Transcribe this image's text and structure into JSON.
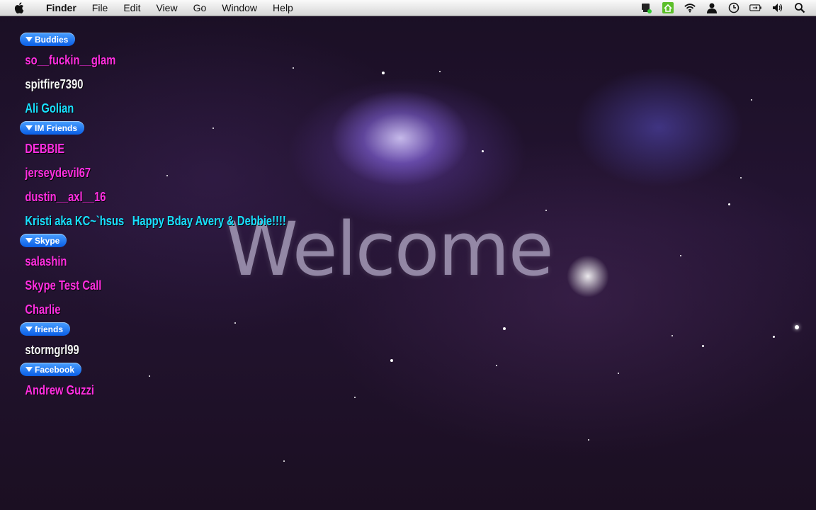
{
  "menubar": {
    "app_name": "Finder",
    "menus": [
      "File",
      "Edit",
      "View",
      "Go",
      "Window",
      "Help"
    ],
    "status_icons": [
      "growl-icon",
      "home-icon",
      "wifi-icon",
      "user-icon",
      "clock-icon",
      "battery-icon",
      "volume-icon",
      "spotlight-icon"
    ]
  },
  "desktop": {
    "welcome_text": "Welcome"
  },
  "buddy_list": {
    "groups": [
      {
        "name": "Buddies",
        "buddies": [
          {
            "name": "so__fuckin__glam",
            "color": "#ff2ee0"
          },
          {
            "name": "spitfire7390",
            "color": "#f4f4f4"
          },
          {
            "name": "Ali Golian",
            "color": "#19e0ff"
          }
        ]
      },
      {
        "name": "IM Friends",
        "buddies": [
          {
            "name": "DEBBIE",
            "color": "#ff2ee0"
          },
          {
            "name": "jerseydevil67",
            "color": "#ff2ee0"
          },
          {
            "name": "dustin__axl__16",
            "color": "#ff2ee0"
          },
          {
            "name": "Kristi aka KC~`hsus",
            "status": "Happy Bday Avery & Debbie!!!!",
            "color": "#19e0ff"
          }
        ]
      },
      {
        "name": "Skype",
        "buddies": [
          {
            "name": "salashin",
            "color": "#ff2ee0"
          },
          {
            "name": "Skype Test Call",
            "color": "#ff2ee0"
          },
          {
            "name": "Charlie",
            "color": "#ff2ee0"
          }
        ]
      },
      {
        "name": "friends",
        "buddies": [
          {
            "name": "stormgrl99",
            "color": "#f4f4f4"
          }
        ]
      },
      {
        "name": "Facebook",
        "buddies": [
          {
            "name": "Andrew Guzzi",
            "color": "#ff2ee0"
          }
        ]
      }
    ]
  }
}
